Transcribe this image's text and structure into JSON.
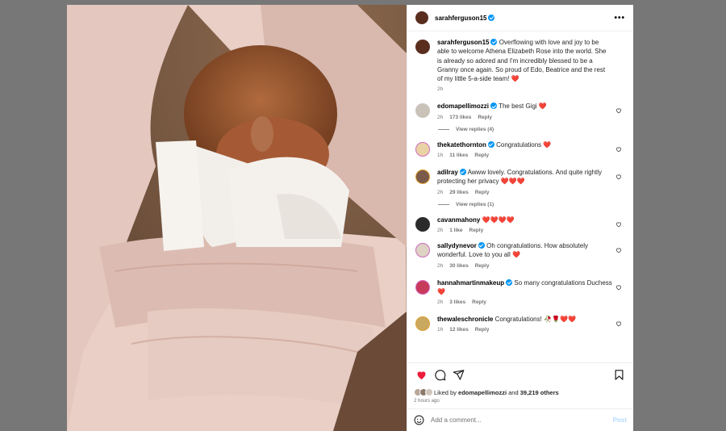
{
  "header": {
    "username": "sarahferguson15",
    "more_icon": "more-horizontal-icon"
  },
  "caption": {
    "username": "sarahferguson15",
    "text": "Overflowing with love and joy to be able to welcome Athena Elizabeth Rose into the world. She is already so adored and I'm incredibly blessed to be a Granny once again. So proud of Edo, Beatrice and the rest of my little 5-a-side team! ❤️",
    "time": "2h"
  },
  "comments": [
    {
      "username": "edomapellimozzi",
      "verified": true,
      "text": "The best Gigi ❤️",
      "time": "2h",
      "likes": "173 likes",
      "reply": "Reply",
      "view_replies": "View replies (4)"
    },
    {
      "username": "thekatethornton",
      "verified": true,
      "text": "Congratulations ❤️",
      "time": "1h",
      "likes": "11 likes",
      "reply": "Reply"
    },
    {
      "username": "adilray",
      "verified": true,
      "text": "Awww lovely. Congratulations. And quite rightly protecting her privacy ❤️❤️❤️",
      "time": "2h",
      "likes": "29 likes",
      "reply": "Reply",
      "view_replies": "View replies (1)"
    },
    {
      "username": "cavanmahony",
      "verified": false,
      "text": "❤️❤️❤️❤️",
      "time": "2h",
      "likes": "1 like",
      "reply": "Reply"
    },
    {
      "username": "sallydynevor",
      "verified": true,
      "text": "Oh congratulations. How absolutely wonderful. Love to you all ❤️",
      "time": "2h",
      "likes": "30 likes",
      "reply": "Reply"
    },
    {
      "username": "hannahmartinmakeup",
      "verified": true,
      "text": "So many congratulations Duchess ❤️",
      "time": "2h",
      "likes": "3 likes",
      "reply": "Reply"
    },
    {
      "username": "thewaleschronicle",
      "verified": false,
      "text": "Congratulations! 🥀🌹❤️❤️",
      "time": "1h",
      "likes": "12 likes",
      "reply": "Reply"
    }
  ],
  "liked_by": {
    "prefix": "Liked by",
    "user": "edomapellimozzi",
    "and": "and",
    "others": "39,219 others"
  },
  "post_time": "2 hours ago",
  "add_comment": {
    "placeholder": "Add a comment...",
    "post_label": "Post"
  },
  "colors": {
    "like_red": "#ed1c3b",
    "verified_blue": "#0095f6"
  }
}
